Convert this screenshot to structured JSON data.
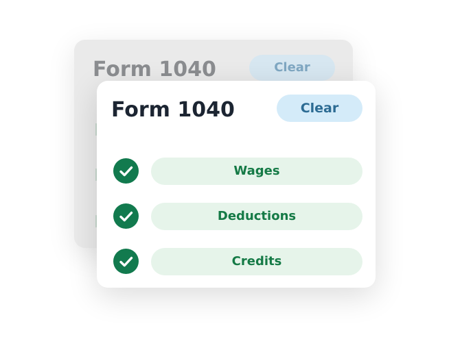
{
  "back_card": {
    "title": "Form 1040",
    "clear_label": "Clear"
  },
  "front_card": {
    "title": "Form 1040",
    "clear_label": "Clear",
    "items": [
      {
        "label": "Wages",
        "checked": true,
        "icon": "check-circle-icon"
      },
      {
        "label": "Deductions",
        "checked": true,
        "icon": "check-circle-icon"
      },
      {
        "label": "Credits",
        "checked": true,
        "icon": "check-circle-icon"
      }
    ]
  },
  "colors": {
    "check_green": "#127a4e",
    "pill_background": "#e6f4ea",
    "pill_text": "#157a46",
    "clear_background": "#d4ebf9",
    "clear_text": "#2c6b93",
    "title_text": "#1c2532"
  }
}
